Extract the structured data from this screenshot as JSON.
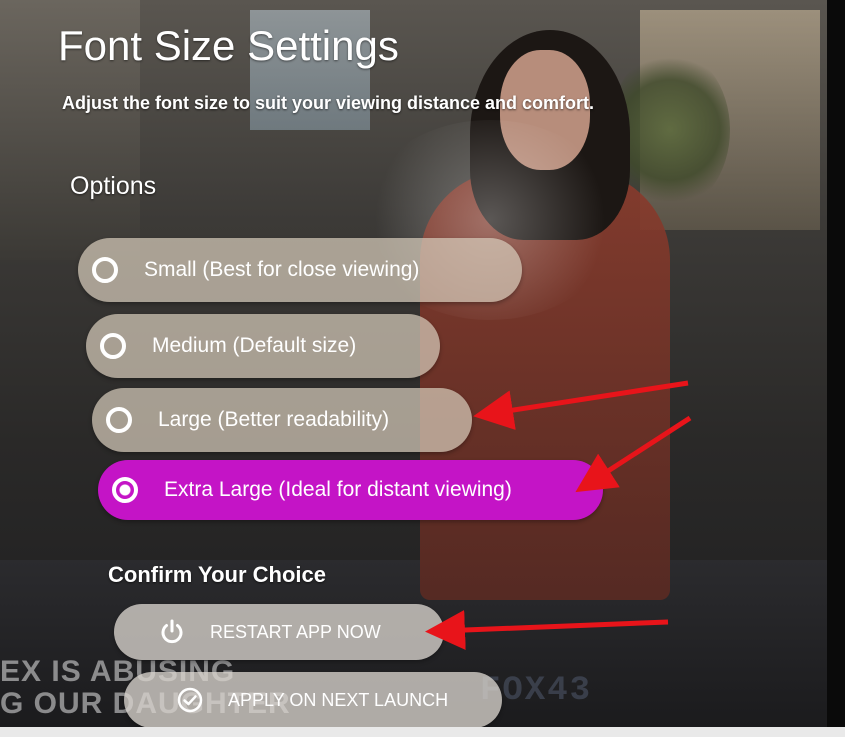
{
  "header": {
    "title": "Font Size Settings",
    "subtitle": "Adjust the font size to suit your viewing distance and comfort."
  },
  "options": {
    "heading": "Options",
    "items": [
      {
        "label": "Small (Best for close viewing)",
        "selected": false
      },
      {
        "label": "Medium (Default size)",
        "selected": false
      },
      {
        "label": "Large (Better readability)",
        "selected": false
      },
      {
        "label": "Extra Large (Ideal for distant viewing)",
        "selected": true
      }
    ]
  },
  "confirm": {
    "heading": "Confirm Your Choice",
    "restart_label": "RESTART APP NOW",
    "apply_label": "APPLY ON NEXT LAUNCH"
  },
  "background_overlay": {
    "line1": "EX IS ABUSING",
    "line2": "G OUR DAUGHTER",
    "right_text": "FOX43"
  },
  "colors": {
    "selected": "#c414c6",
    "option_bg": "#d6cab8",
    "arrow": "#e8141a"
  },
  "icons": {
    "restart": "power-icon",
    "apply": "check-circle-icon"
  }
}
